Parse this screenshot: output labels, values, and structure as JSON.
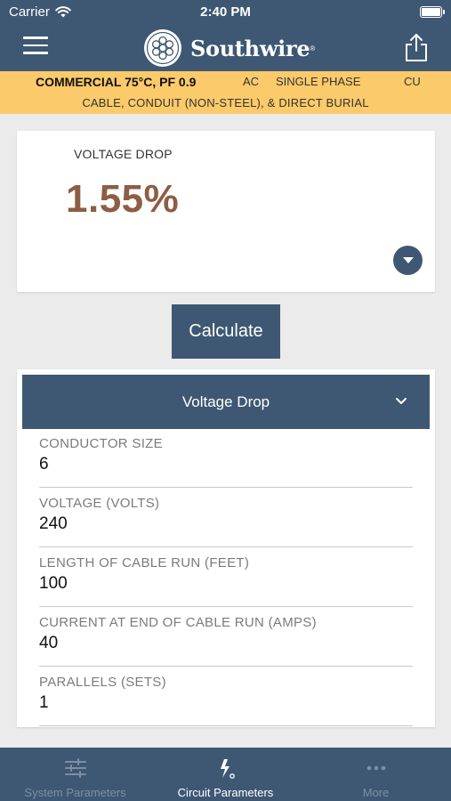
{
  "status_bar": {
    "carrier": "Carrier",
    "time": "2:40 PM"
  },
  "header": {
    "brand": "Southwire",
    "menu_icon": "hamburger-menu-icon",
    "share_icon": "share-icon"
  },
  "banner": {
    "title": "COMMERCIAL 75°C, PF 0.9",
    "current_type": "AC",
    "phase": "SINGLE PHASE",
    "conductor_material": "CU",
    "installation": "CABLE, CONDUIT (NON-STEEL), & DIRECT BURIAL"
  },
  "result": {
    "label": "VOLTAGE DROP",
    "value": "1.55%"
  },
  "calculate_label": "Calculate",
  "section": {
    "title": "Voltage Drop"
  },
  "fields": [
    {
      "label": "CONDUCTOR SIZE",
      "value": "6"
    },
    {
      "label": "VOLTAGE (VOLTS)",
      "value": "240"
    },
    {
      "label": "LENGTH OF CABLE RUN (FEET)",
      "value": "100"
    },
    {
      "label": "CURRENT AT END OF CABLE RUN (AMPS)",
      "value": "40"
    },
    {
      "label": "PARALLELS (SETS)",
      "value": "1"
    }
  ],
  "tabs": [
    {
      "label": "System Parameters",
      "icon": "sliders-icon",
      "active": false
    },
    {
      "label": "Circuit Parameters",
      "icon": "lightning-icon",
      "active": true
    },
    {
      "label": "More",
      "icon": "more-dots-icon",
      "active": false
    }
  ],
  "colors": {
    "primary": "#3e5873",
    "banner": "#fbca6a",
    "result_value": "#8c5e43"
  }
}
